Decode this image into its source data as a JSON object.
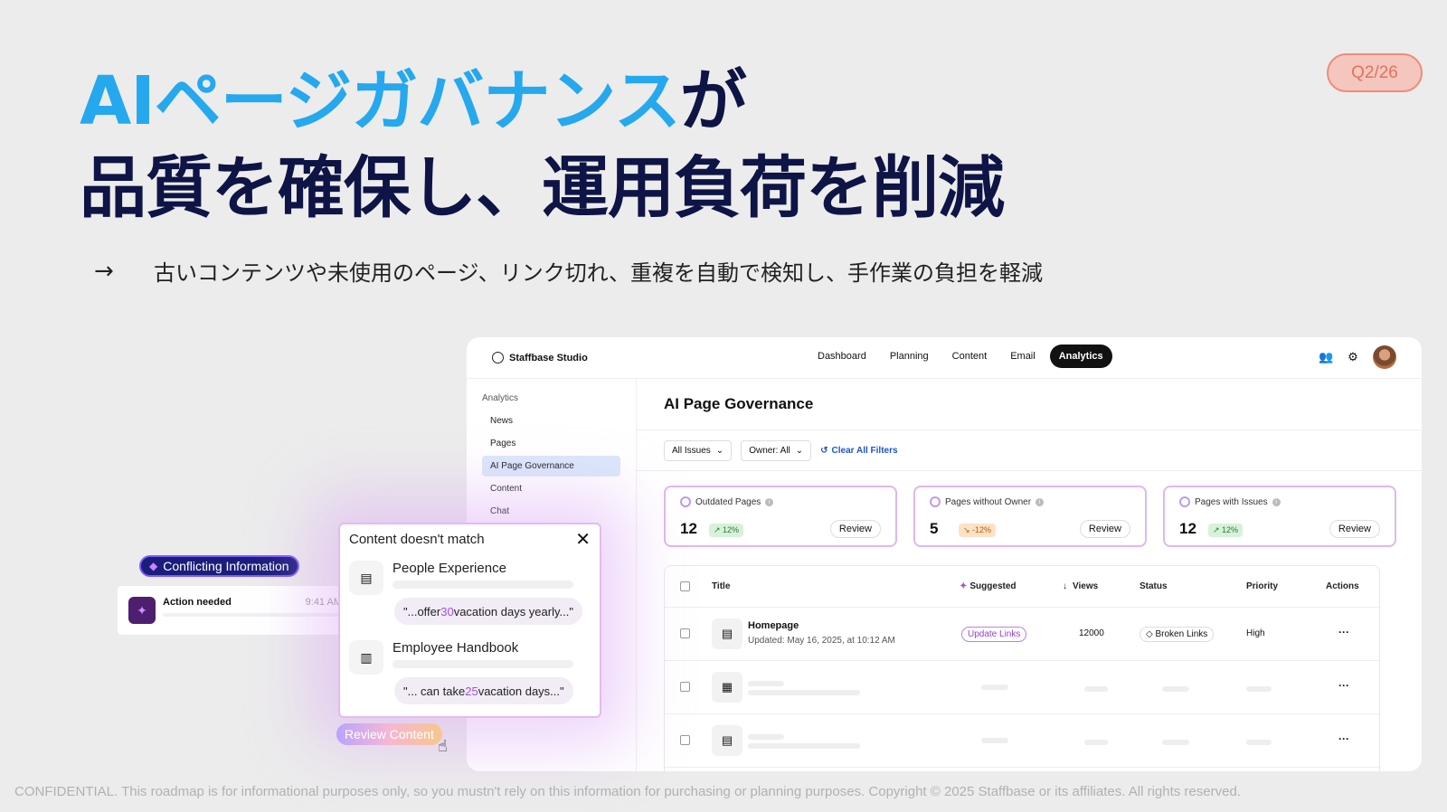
{
  "slide": {
    "title_highlight": "AIページガバナンス",
    "title_rest": "が",
    "title_line2": "品質を確保し、運用負荷を削減",
    "quarter": "Q2/26",
    "bullet_arrow": "→",
    "bullet_text": "古いコンテンツや未使用のページ、リンク切れ、重複を自動で検知し、手作業の負担を軽減",
    "footer": "CONFIDENTIAL. This roadmap is for informational purposes only, so you mustn't rely on this information for purchasing or planning purposes. Copyright © 2025 Staffbase or its affiliates. All rights reserved.",
    "accent_color": "#25a8ee",
    "title_color": "#0e1445"
  },
  "app": {
    "brand": "Staffbase Studio",
    "nav": [
      "Dashboard",
      "Planning",
      "Content",
      "Email",
      "Analytics"
    ],
    "nav_active": "Analytics",
    "sidebar": {
      "heading": "Analytics",
      "items": [
        "News",
        "Pages",
        "AI Page Governance",
        "Content",
        "Chat"
      ],
      "active": "AI Page Governance"
    },
    "page_title": "AI Page Governance",
    "filters": {
      "issues": "All Issues",
      "owner": "Owner: All",
      "clear": "Clear All Filters"
    },
    "cards": [
      {
        "title": "Outdated Pages",
        "value": "12",
        "delta": "↗ 12%",
        "action": "Review"
      },
      {
        "title": "Pages without Owner",
        "value": "5",
        "delta": "↘ -12%",
        "action": "Review"
      },
      {
        "title": "Pages with Issues",
        "value": "12",
        "delta": "↗ 12%",
        "action": "Review"
      }
    ],
    "table": {
      "headers": {
        "title": "Title",
        "suggested": "Suggested",
        "views": "Views",
        "status": "Status",
        "priority": "Priority",
        "actions": "Actions"
      },
      "rows": [
        {
          "title": "Homepage",
          "updated": "Updated: May 16, 2025, at 10:12 AM",
          "suggested": "Update Links",
          "views": "12000",
          "status": "Broken Links",
          "priority": "High",
          "actions": "···"
        },
        {
          "actions": "···"
        },
        {
          "actions": "···"
        }
      ]
    }
  },
  "overlay": {
    "popup_title": "Content doesn't match",
    "items": [
      {
        "name": "People Experience",
        "quote_pre": "\"...offer ",
        "quote_num": "30",
        "quote_post": " vacation days yearly...\""
      },
      {
        "name": "Employee Handbook",
        "quote_pre": "\"... can take ",
        "quote_num": "25",
        "quote_post": " vacation days...\""
      }
    ],
    "conflict_badge": "Conflicting Information",
    "notification": {
      "title": "Action needed",
      "time": "9:41 AM"
    },
    "review_button": "Review Content"
  }
}
